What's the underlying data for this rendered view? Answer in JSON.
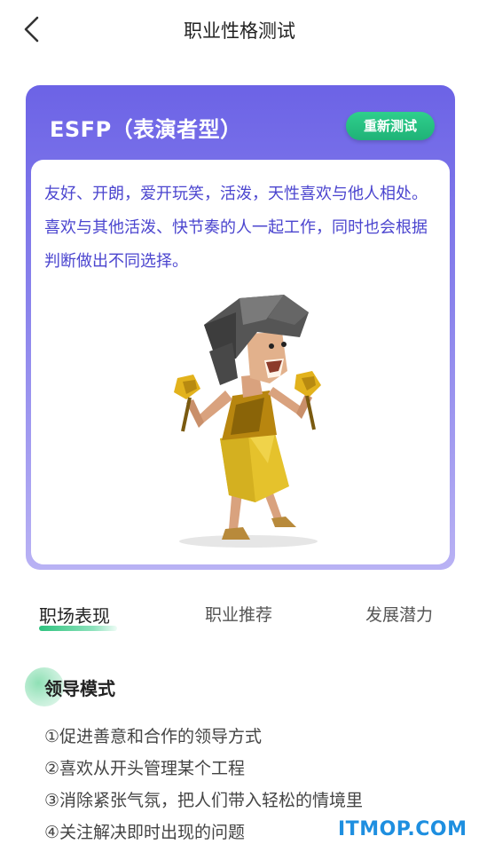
{
  "header": {
    "title": "职业性格测试",
    "back_icon": "chevron-left-icon"
  },
  "card": {
    "type_title": "ESFP（表演者型）",
    "retest_label": "重新测试",
    "description": "友好、开朗，爱开玩笑，活泼，天性喜欢与他人相处。喜欢与其他活泼、快节奏的人一起工作，同时也会根据判断做出不同选择。",
    "accent_color": "#6c63e6",
    "retest_color": "#22b87a"
  },
  "tabs": [
    {
      "label": "职场表现",
      "active": true
    },
    {
      "label": "职业推荐",
      "active": false
    },
    {
      "label": "发展潜力",
      "active": false
    }
  ],
  "section": {
    "title": "领导模式",
    "items": [
      "①促进善意和合作的领导方式",
      "②喜欢从开头管理某个工程",
      "③消除紧张气氛，把人们带入轻松的情境里",
      "④关注解决即时出现的问题"
    ]
  },
  "watermark": "ITMOP.COM"
}
